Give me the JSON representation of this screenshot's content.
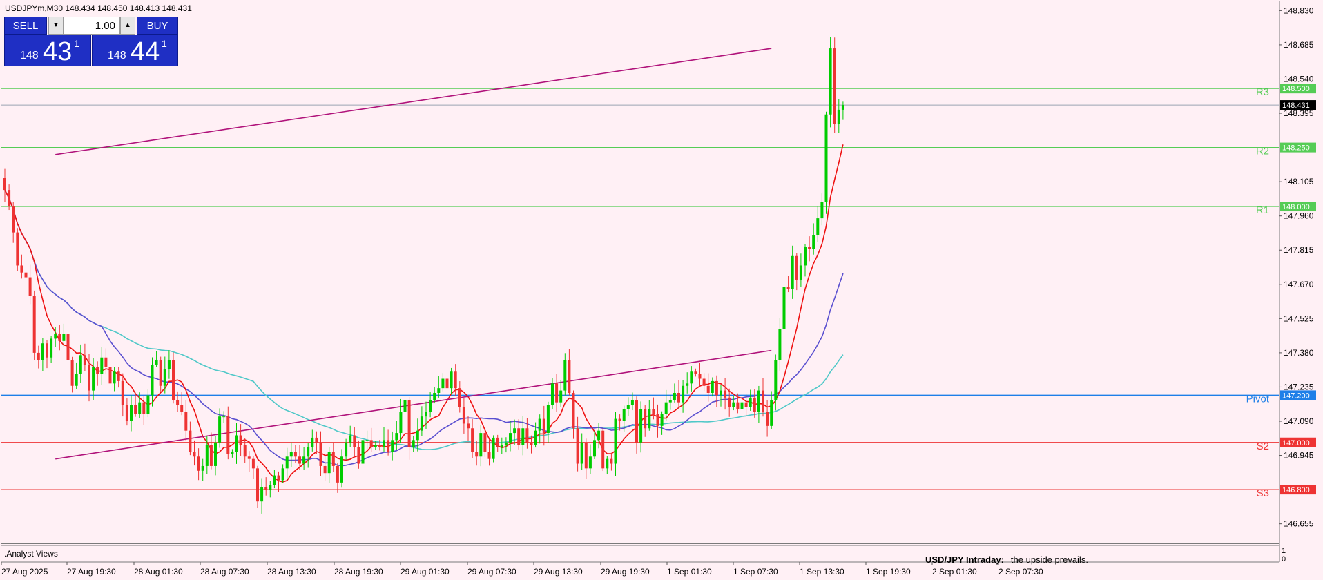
{
  "header": {
    "symbol_line": "USDJPYm,M30  148.434 148.450 148.413 148.431"
  },
  "trade_panel": {
    "sell_label": "SELL",
    "buy_label": "BUY",
    "lot": "1.00",
    "dec_symbol": "▼",
    "inc_symbol": "▲",
    "sell_price": {
      "small": "148",
      "big": "43",
      "sup": "1"
    },
    "buy_price": {
      "small": "148",
      "big": "44",
      "sup": "1"
    }
  },
  "indicator_window": {
    "label": ".Analyst Views",
    "scale_top": "1",
    "scale_bottom": "0"
  },
  "annotation": {
    "title": "USD/JPY Intraday:",
    "text": "the upside prevails."
  },
  "current_price": "148.431",
  "colors": {
    "background": "#fff0f5",
    "bull": "#00cc00",
    "bear": "#ee3333",
    "resistance": "#55cc55",
    "support": "#ee3333",
    "pivot": "#1e7fe8",
    "trendline": "#b0127a",
    "ma_fast": "#ee1111",
    "ma_mid": "#5a4fd0",
    "ma_slow": "#4fc8c8"
  },
  "chart_data": {
    "type": "candlestick",
    "symbol": "USDJPYm",
    "timeframe": "M30",
    "ylim": [
      146.575,
      148.875
    ],
    "y_ticks": [
      "148.830",
      "148.685",
      "148.540",
      "148.395",
      "148.105",
      "147.960",
      "147.815",
      "147.670",
      "147.525",
      "147.380",
      "147.235",
      "147.090",
      "146.945",
      "146.655"
    ],
    "x_ticks": [
      "27 Aug 2025",
      "27 Aug 19:30",
      "28 Aug 01:30",
      "28 Aug 07:30",
      "28 Aug 13:30",
      "28 Aug 19:30",
      "29 Aug 01:30",
      "29 Aug 07:30",
      "29 Aug 13:30",
      "29 Aug 19:30",
      "1 Sep 01:30",
      "1 Sep 07:30",
      "1 Sep 13:30",
      "1 Sep 19:30",
      "2 Sep 01:30",
      "2 Sep 07:30"
    ],
    "levels": [
      {
        "label": "R3",
        "value": 148.5,
        "price_label": "148.500",
        "kind": "resistance"
      },
      {
        "label": "R2",
        "value": 148.25,
        "price_label": "148.250",
        "kind": "resistance"
      },
      {
        "label": "R1",
        "value": 148.0,
        "price_label": "148.000",
        "kind": "resistance"
      },
      {
        "label": "Pivot",
        "value": 147.2,
        "price_label": "147.200",
        "kind": "pivot"
      },
      {
        "label": "S2",
        "value": 147.0,
        "price_label": "147.000",
        "kind": "support"
      },
      {
        "label": "S3",
        "value": 146.8,
        "price_label": "146.800",
        "kind": "support"
      }
    ],
    "trendlines": [
      {
        "from": [
          12,
          148.22
        ],
        "to": [
          182,
          148.67
        ]
      },
      {
        "from": [
          12,
          146.93
        ],
        "to": [
          182,
          147.39
        ]
      }
    ],
    "closes": [
      148.07,
      148.0,
      147.89,
      147.75,
      147.72,
      147.7,
      147.62,
      147.38,
      147.35,
      147.42,
      147.36,
      147.44,
      147.46,
      147.43,
      147.46,
      147.35,
      147.24,
      147.29,
      147.37,
      147.33,
      147.22,
      147.32,
      147.29,
      147.36,
      147.32,
      147.25,
      147.3,
      147.26,
      147.16,
      147.09,
      147.16,
      147.12,
      147.17,
      147.12,
      147.2,
      147.33,
      147.35,
      147.24,
      147.31,
      147.35,
      147.18,
      147.16,
      147.13,
      147.05,
      146.96,
      146.94,
      146.88,
      146.9,
      146.99,
      146.9,
      147.0,
      147.11,
      147.11,
      146.95,
      146.96,
      147.03,
      146.99,
      146.94,
      146.93,
      146.89,
      146.75,
      146.81,
      146.8,
      146.82,
      146.86,
      146.84,
      146.89,
      146.94,
      146.96,
      146.94,
      146.91,
      146.94,
      146.98,
      147.02,
      147.0,
      146.9,
      146.87,
      146.96,
      146.9,
      146.83,
      146.94,
      147.0,
      147.03,
      146.98,
      146.91,
      147.01,
      147.01,
      146.98,
      146.99,
      146.98,
      147.01,
      146.96,
      147.01,
      147.04,
      147.13,
      147.18,
      146.98,
      147.01,
      147.05,
      147.11,
      147.13,
      147.18,
      147.21,
      147.23,
      147.27,
      147.23,
      147.3,
      147.23,
      147.15,
      147.08,
      147.06,
      146.96,
      146.94,
      147.04,
      146.96,
      146.93,
      147.02,
      146.98,
      146.99,
      147.0,
      147.04,
      147.06,
      146.99,
      147.06,
      147.0,
      146.99,
      147.05,
      147.1,
      147.04,
      147.16,
      147.25,
      147.17,
      147.22,
      147.35,
      147.21,
      147.06,
      146.91,
      147.0,
      146.89,
      146.94,
      147.01,
      147.05,
      146.89,
      146.93,
      146.91,
      147.1,
      147.09,
      147.14,
      147.16,
      147.18,
      147.0,
      147.14,
      147.06,
      147.14,
      147.12,
      147.07,
      147.12,
      147.17,
      147.18,
      147.21,
      147.17,
      147.24,
      147.25,
      147.3,
      147.29,
      147.27,
      147.24,
      147.21,
      147.26,
      147.2,
      147.22,
      147.19,
      147.15,
      147.17,
      147.14,
      147.17,
      147.15,
      147.19,
      147.13,
      147.22,
      147.13,
      147.07,
      147.18,
      147.35,
      147.48,
      147.66,
      147.65,
      147.79,
      147.69,
      147.75,
      147.83,
      147.82,
      147.88,
      147.95,
      148.02,
      148.39,
      148.67,
      148.35,
      148.41,
      148.43
    ]
  }
}
